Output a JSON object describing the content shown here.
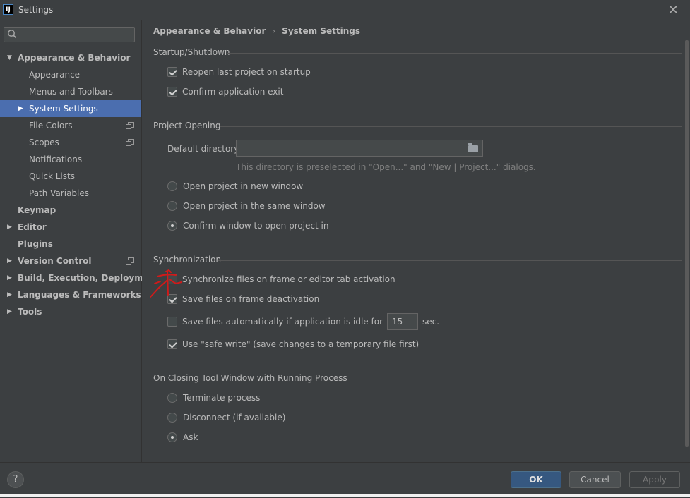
{
  "window": {
    "title": "Settings",
    "app_icon_text": "IJ"
  },
  "search": {
    "placeholder": ""
  },
  "sidebar": {
    "items": [
      {
        "label": "Appearance & Behavior",
        "bold": true,
        "expanded": true
      },
      {
        "label": "Appearance"
      },
      {
        "label": "Menus and Toolbars"
      },
      {
        "label": "System Settings",
        "selected": true
      },
      {
        "label": "File Colors"
      },
      {
        "label": "Scopes"
      },
      {
        "label": "Notifications"
      },
      {
        "label": "Quick Lists"
      },
      {
        "label": "Path Variables"
      },
      {
        "label": "Keymap",
        "bold": true
      },
      {
        "label": "Editor",
        "bold": true
      },
      {
        "label": "Plugins",
        "bold": true
      },
      {
        "label": "Version Control",
        "bold": true
      },
      {
        "label": "Build, Execution, Deployment",
        "bold": true
      },
      {
        "label": "Languages & Frameworks",
        "bold": true
      },
      {
        "label": "Tools",
        "bold": true
      }
    ]
  },
  "breadcrumb": {
    "parent": "Appearance & Behavior",
    "separator": "›",
    "current": "System Settings"
  },
  "startup": {
    "title": "Startup/Shutdown",
    "reopen_label": "Reopen last project on startup",
    "reopen_checked": true,
    "confirm_exit_label": "Confirm application exit",
    "confirm_exit_checked": true
  },
  "project_opening": {
    "title": "Project Opening",
    "default_dir_label": "Default directory:",
    "default_dir_value": "",
    "hint": "This directory is preselected in \"Open...\" and \"New | Project...\" dialogs.",
    "options": [
      "Open project in new window",
      "Open project in the same window",
      "Confirm window to open project in"
    ],
    "selected_option": 2
  },
  "sync": {
    "title": "Synchronization",
    "sync_frame_label": "Synchronize files on frame or editor tab activation",
    "sync_frame_checked": false,
    "save_deactivation_label": "Save files on frame deactivation",
    "save_deactivation_checked": true,
    "save_idle_label": "Save files automatically if application is idle for",
    "save_idle_checked": false,
    "idle_seconds": "15",
    "idle_unit": "sec.",
    "safe_write_label": "Use \"safe write\" (save changes to a temporary file first)",
    "safe_write_checked": true
  },
  "closing": {
    "title": "On Closing Tool Window with Running Process",
    "options": [
      "Terminate process",
      "Disconnect (if available)",
      "Ask"
    ],
    "selected_option": 2
  },
  "footer": {
    "help_label": "?",
    "ok_label": "OK",
    "cancel_label": "Cancel",
    "apply_label": "Apply"
  },
  "colors": {
    "background": "#3c3f41",
    "selection": "#4b6eaf",
    "ok_button": "#365880",
    "annotation": "#d01a1a"
  }
}
